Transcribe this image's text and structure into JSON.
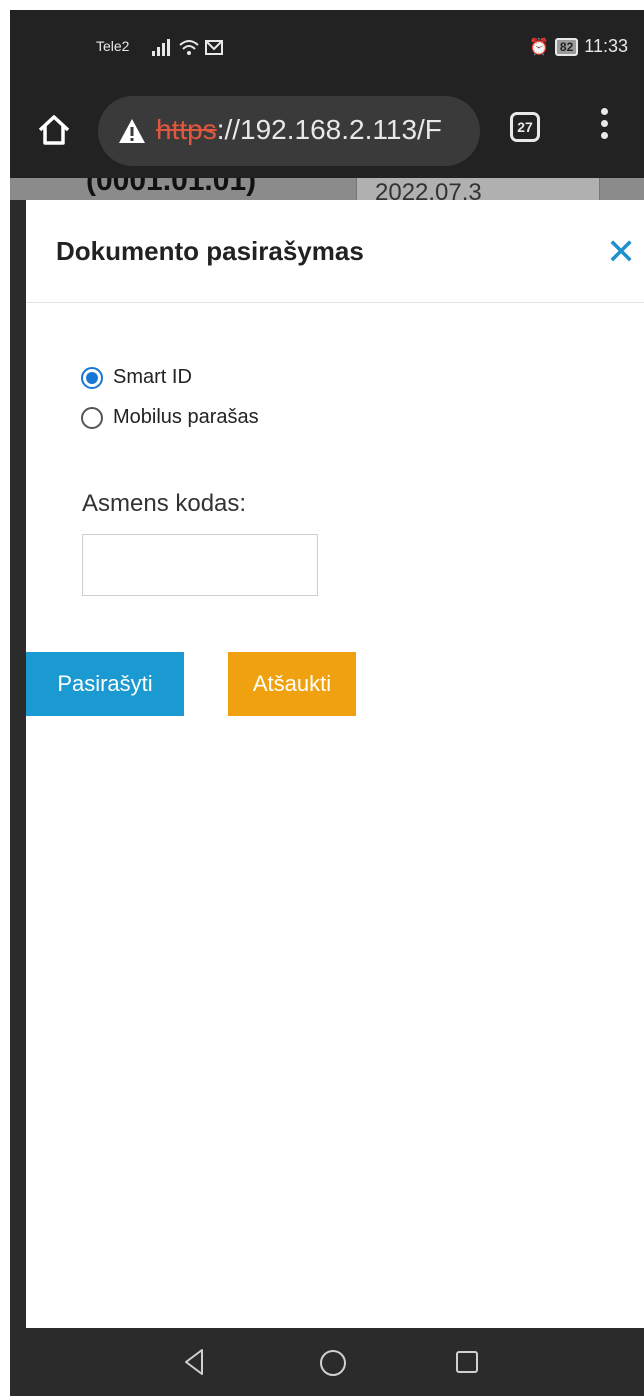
{
  "status_bar": {
    "carrier": "Tele2",
    "battery": "82",
    "time": "11:33"
  },
  "browser": {
    "url_scheme": "https",
    "url_rest": "://192.168.2.113/F",
    "tab_count": "27"
  },
  "background_page": {
    "date_text": "(0001.01.01)",
    "select_value": "2022.07.3"
  },
  "modal": {
    "title": "Dokumento pasirašymas",
    "close_glyph": "✕",
    "sign_methods": [
      {
        "label": "Smart ID",
        "checked": true
      },
      {
        "label": "Mobilus parašas",
        "checked": false
      }
    ],
    "personal_code_label": "Asmens kodas:",
    "personal_code_value": "",
    "sign_button": "Pasirašyti",
    "cancel_button": "Atšaukti"
  },
  "colors": {
    "sign_button": "#1a9ad0",
    "cancel_button": "#f0a10f",
    "close_icon": "#1e8fd0",
    "radio_checked": "#1976d2"
  }
}
